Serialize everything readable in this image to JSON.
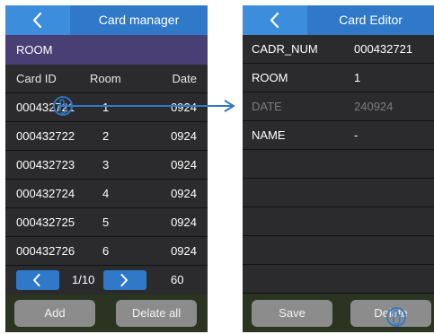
{
  "left": {
    "title": "Card manager",
    "room_bar": "ROOM",
    "headers": {
      "card_id": "Card ID",
      "room": "Room",
      "date": "Date"
    },
    "rows": [
      {
        "card_id": "000432721",
        "room": "1",
        "date": "0924"
      },
      {
        "card_id": "000432722",
        "room": "2",
        "date": "0924"
      },
      {
        "card_id": "000432723",
        "room": "3",
        "date": "0924"
      },
      {
        "card_id": "000432724",
        "room": "4",
        "date": "0924"
      },
      {
        "card_id": "000432725",
        "room": "5",
        "date": "0924"
      },
      {
        "card_id": "000432726",
        "room": "6",
        "date": "0924"
      }
    ],
    "pager": {
      "page": "1/10",
      "total": "60"
    },
    "add_label": "Add",
    "delete_all_label": "Delate all"
  },
  "right": {
    "title": "Card Editor",
    "fields": [
      {
        "label": "CADR_NUM",
        "value": "000432721"
      },
      {
        "label": "ROOM",
        "value": "1"
      },
      {
        "label": "DATE",
        "value": "240924"
      },
      {
        "label": "NAME",
        "value": "-"
      }
    ],
    "save_label": "Save",
    "delete_label": "Delate"
  },
  "icons": {
    "back": "chevron-left-icon",
    "prev": "chevron-left-icon",
    "next": "chevron-right-icon",
    "touch": "touch-finger-icon",
    "arrow": "arrow-right-icon"
  },
  "colors": {
    "titlebar": "#2f79c8",
    "room_bar": "#4a3f74",
    "panel": "#2b2b2d",
    "button": "#8c8c8c"
  }
}
